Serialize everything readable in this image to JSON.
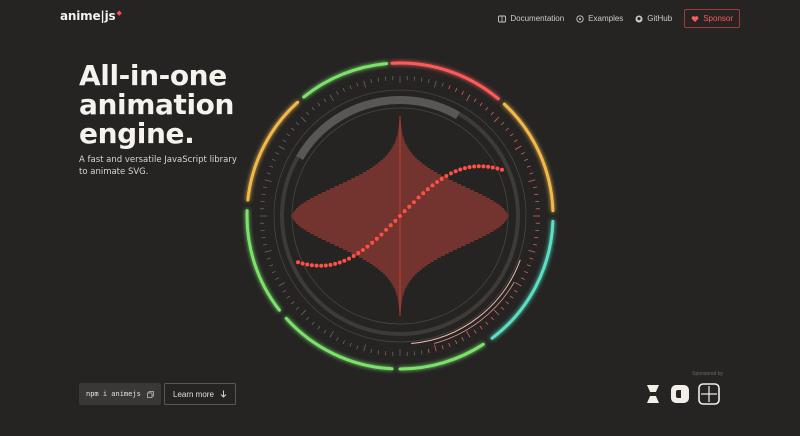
{
  "header": {
    "logo": "anime",
    "logo_suffix": "js",
    "nav": [
      {
        "label": "Documentation",
        "icon": "book-icon"
      },
      {
        "label": "Examples",
        "icon": "examples-icon"
      },
      {
        "label": "GitHub",
        "icon": "github-icon"
      }
    ],
    "sponsor_label": "Sponsor"
  },
  "hero": {
    "title_lines": [
      "All-in-one",
      "animation",
      "engine."
    ],
    "subtitle": "A fast and versatile JavaScript library to animate SVG."
  },
  "actions": {
    "install_command": "npm i animejs",
    "learn_more": "Learn more"
  },
  "sponsored": {
    "label": "Sponsored by"
  },
  "colors": {
    "background": "#252423",
    "accent_red": "#ff4b4b",
    "ring_green": "#7be36b",
    "ring_yellow": "#f2b94a",
    "ring_teal": "#59e0c3",
    "ring_red": "#ff5a5a"
  }
}
